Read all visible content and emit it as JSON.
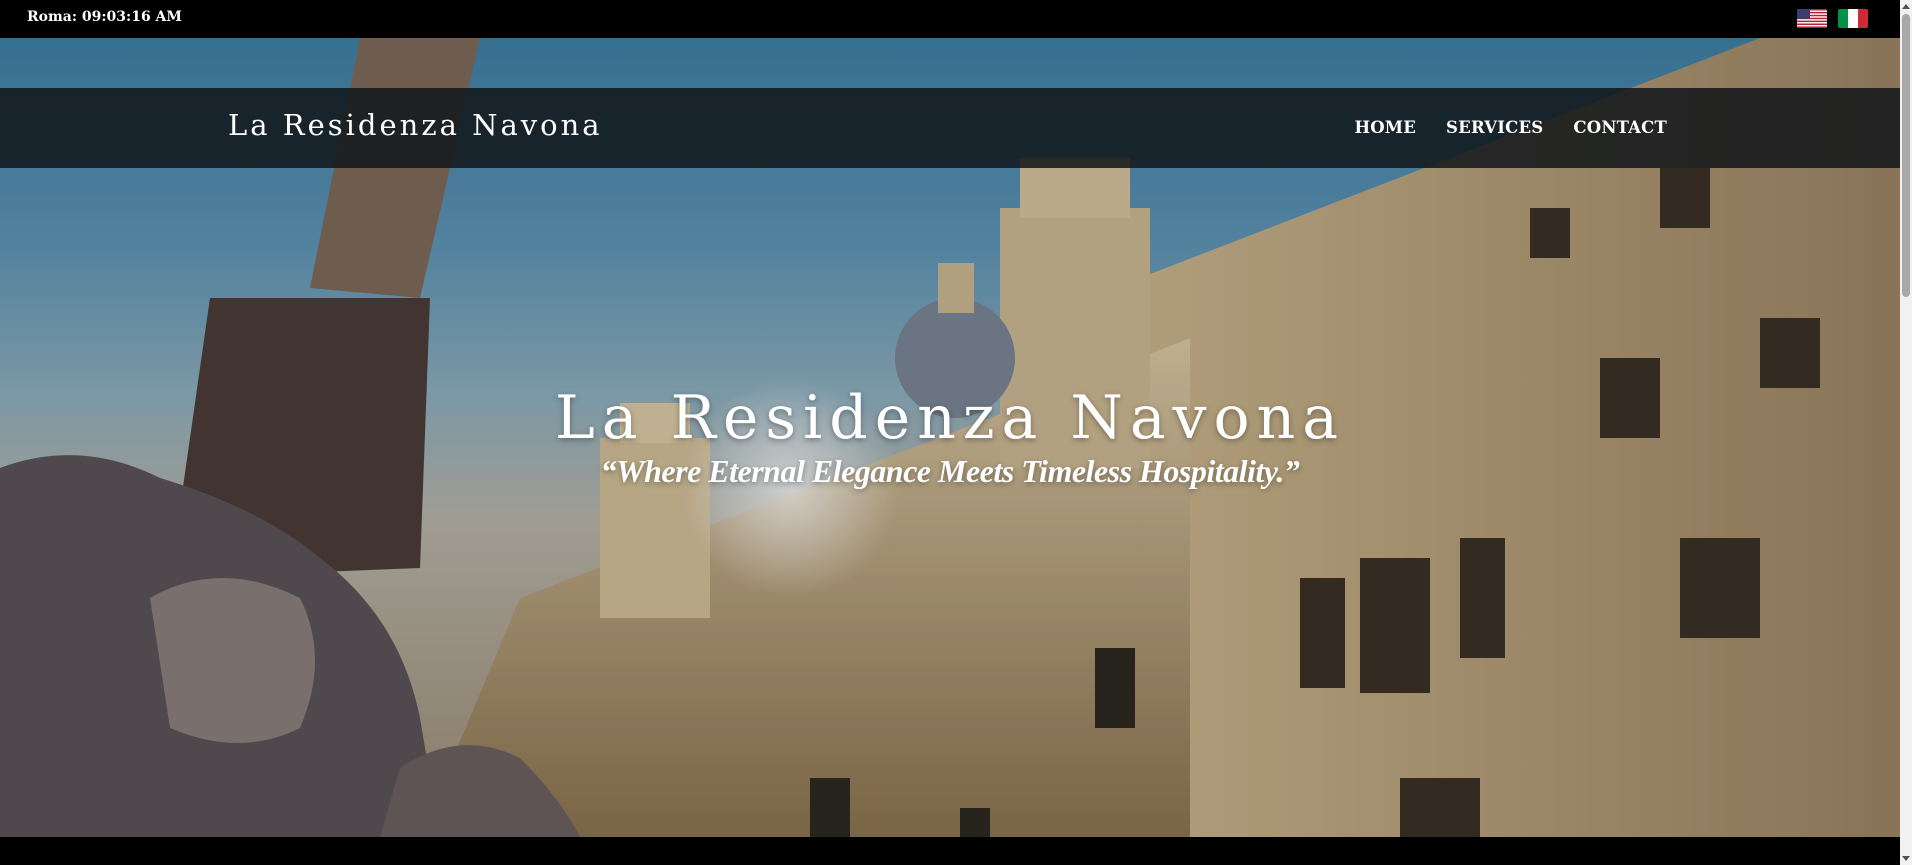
{
  "clock": {
    "text": "Roma: 09:03:16 AM"
  },
  "languages": [
    {
      "name": "english-flag-icon",
      "colors": [
        "#b22234",
        "#ffffff",
        "#3c3b6e"
      ]
    },
    {
      "name": "italian-flag-icon",
      "colors": [
        "#009246",
        "#ffffff",
        "#ce2b37"
      ]
    }
  ],
  "header": {
    "brand": "La Residenza Navona",
    "nav": [
      "HOME",
      "SERVICES",
      "CONTACT"
    ]
  },
  "hero": {
    "title": "La Residenza Navona",
    "tagline": "“Where Eternal Elegance Meets Timeless Hospitality.”"
  }
}
